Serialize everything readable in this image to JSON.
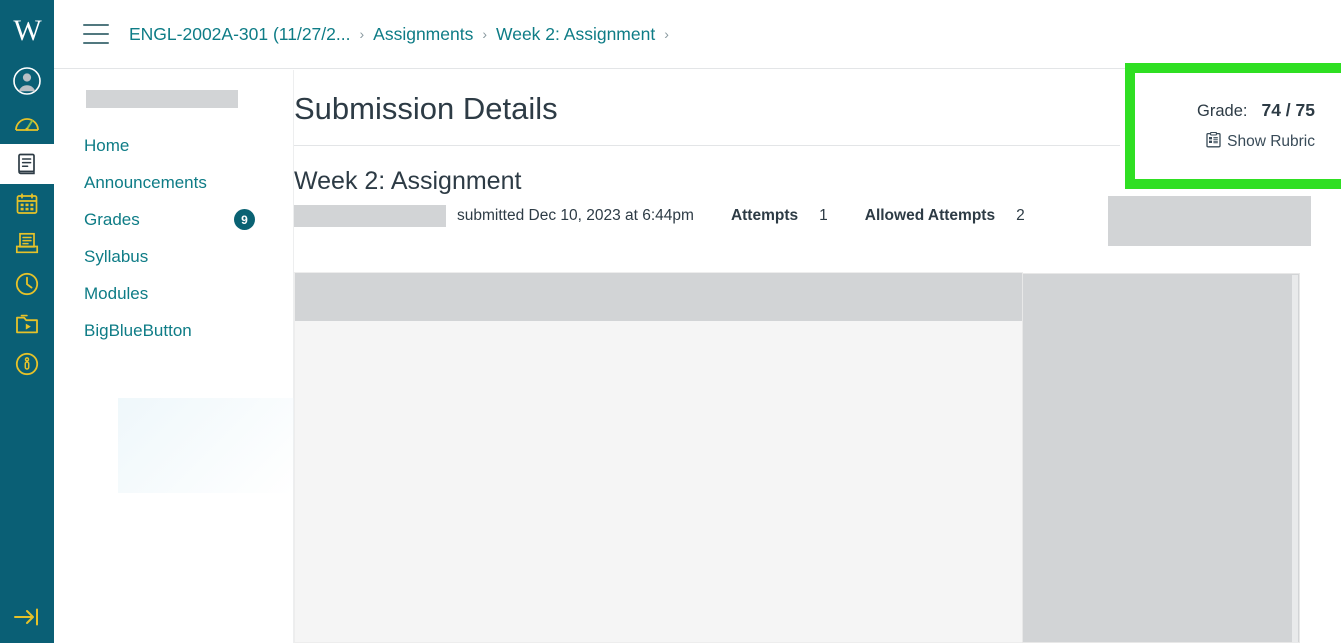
{
  "global_nav": {
    "logo_text": "W",
    "items": [
      {
        "name": "account",
        "label": "Account",
        "icon": "user-circle-icon",
        "active": false
      },
      {
        "name": "dashboard",
        "label": "Dashboard",
        "icon": "dashboard-gauge-icon",
        "active": false
      },
      {
        "name": "courses",
        "label": "Courses",
        "icon": "book-icon",
        "active": true
      },
      {
        "name": "calendar",
        "label": "Calendar",
        "icon": "calendar-icon",
        "active": false
      },
      {
        "name": "inbox",
        "label": "Inbox",
        "icon": "inbox-tray-icon",
        "active": false
      },
      {
        "name": "history",
        "label": "History",
        "icon": "clock-icon",
        "active": false
      },
      {
        "name": "studio",
        "label": "Studio",
        "icon": "folder-play-icon",
        "active": false
      },
      {
        "name": "help",
        "label": "Help",
        "icon": "help-info-circle-icon",
        "active": false
      }
    ],
    "collapse_label": "Minimize Navigation",
    "collapse_icon": "arrow-to-bar-right-icon",
    "background_color": "#0A5F75",
    "icon_color": "#E6C229"
  },
  "topbar": {
    "menu_icon": "hamburger-menu-icon",
    "breadcrumbs": [
      {
        "label": "ENGL-2002A-301 (11/27/2..."
      },
      {
        "label": "Assignments"
      },
      {
        "label": "Week 2: Assignment"
      }
    ],
    "separator": "›",
    "link_color": "#0E7C86"
  },
  "course_nav": {
    "course_name_redacted": "",
    "items": [
      {
        "label": "Home",
        "badge": ""
      },
      {
        "label": "Announcements",
        "badge": ""
      },
      {
        "label": "Grades",
        "badge": "9"
      },
      {
        "label": "Syllabus",
        "badge": ""
      },
      {
        "label": "Modules",
        "badge": ""
      },
      {
        "label": "BigBlueButton",
        "badge": ""
      }
    ],
    "badge_color": "#0A6273"
  },
  "main": {
    "page_title": "Submission Details",
    "assignment_title": "Week 2: Assignment",
    "submitted_text": "submitted Dec 10, 2023 at 6:44pm",
    "attempts_label": "Attempts",
    "attempts_value": "1",
    "allowed_attempts_label": "Allowed Attempts",
    "allowed_attempts_value": "2"
  },
  "grade_box": {
    "grade_label": "Grade:",
    "grade_score": "74 / 75",
    "show_rubric_label": "Show Rubric",
    "rubric_icon": "rubric-clipboard-icon",
    "highlight_color": "#2FDF22"
  },
  "preview": {
    "document_preview_name": "submission-document-preview",
    "side_panel_name": "submission-side-panel"
  }
}
